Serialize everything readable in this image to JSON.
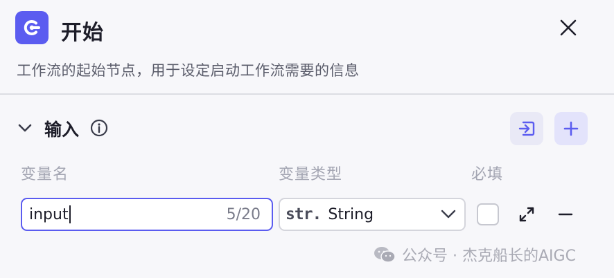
{
  "node": {
    "title": "开始",
    "description": "工作流的起始节点，用于设定启动工作流需要的信息",
    "accent_color": "#5b5cf0"
  },
  "input_section": {
    "title": "输入",
    "columns": {
      "name": "变量名",
      "type": "变量类型",
      "required": "必填"
    },
    "rows": [
      {
        "name": "input",
        "char_count": "5/20",
        "type_abbr": "str.",
        "type": "String",
        "required": false
      }
    ]
  },
  "icons": {
    "node": "start-node-icon",
    "close": "close-icon",
    "collapse": "chevron-down-icon",
    "info": "info-icon",
    "import": "import-icon",
    "add": "plus-icon",
    "expand": "expand-icon",
    "remove": "minus-icon"
  },
  "watermark": {
    "text": "公众号 · 杰克船长的AIGC"
  }
}
